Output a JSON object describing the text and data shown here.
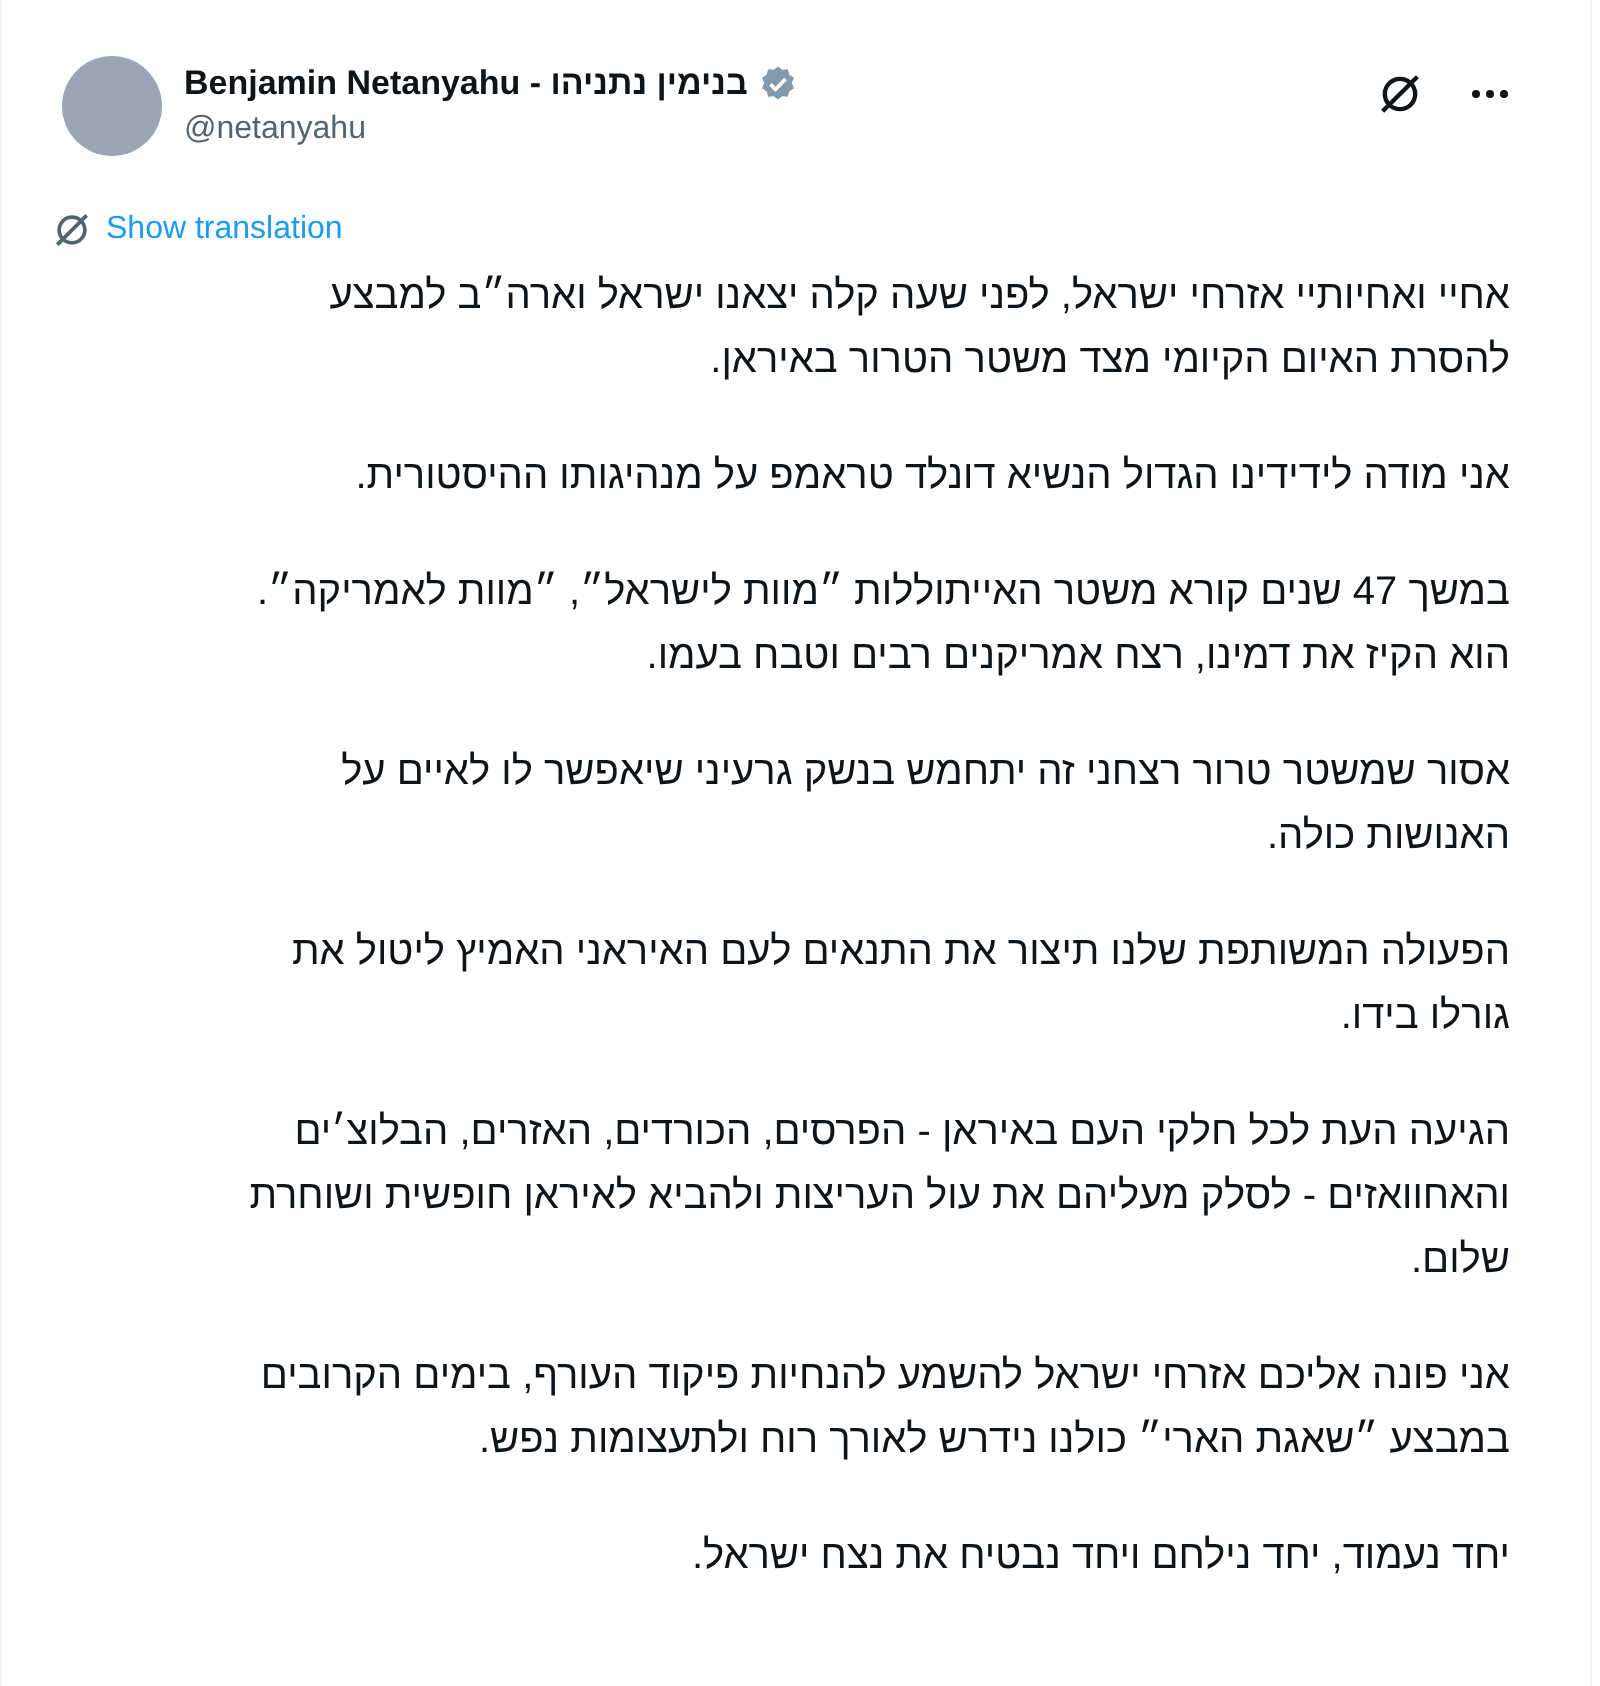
{
  "author": {
    "name": "Benjamin Netanyahu - בנימין נתניהו",
    "handle": "@netanyahu",
    "verified": true
  },
  "translation_link": "Show translation",
  "paragraphs": [
    {
      "lines": [
        "אחיי ואחיותיי אזרחי ישראל, לפני שעה קלה יצאנו ישראל וארה״ב למבצע",
        "להסרת האיום הקיומי מצד משטר הטרור באיראן."
      ]
    },
    {
      "lines": [
        "אני מודה לידידינו הגדול הנשיא דונלד טראמפ על מנהיגותו ההיסטורית."
      ]
    },
    {
      "lines": [
        "במשך 47 שנים קורא משטר האייתוללות ״מוות לישראל״, ״מוות לאמריקה״.",
        "הוא הקיז את דמינו, רצח אמריקנים רבים וטבח בעמו."
      ]
    },
    {
      "lines": [
        "אסור שמשטר טרור רצחני זה יתחמש בנשק גרעיני שיאפשר לו לאיים על",
        "האנושות כולה."
      ]
    },
    {
      "lines": [
        "הפעולה המשותפת שלנו תיצור את התנאים לעם האיראני האמיץ ליטול את",
        "גורלו בידו."
      ]
    },
    {
      "lines": [
        "הגיעה העת לכל חלקי העם באיראן - הפרסים, הכורדים, האזרים, הבלוצ׳ים",
        "והאחוואזים - לסלק מעליהם את עול העריצות ולהביא לאיראן חופשית ושוחרת",
        "שלום."
      ]
    },
    {
      "lines": [
        "אני פונה אליכם אזרחי ישראל להשמע להנחיות פיקוד העורף, בימים הקרובים",
        "במבצע ״שאגת הארי״ כולנו נידרש לאורך רוח ולתעצומות נפש."
      ]
    },
    {
      "lines": [
        "יחד נעמוד, יחד נילחם ויחד נבטיח את נצח ישראל."
      ]
    }
  ]
}
